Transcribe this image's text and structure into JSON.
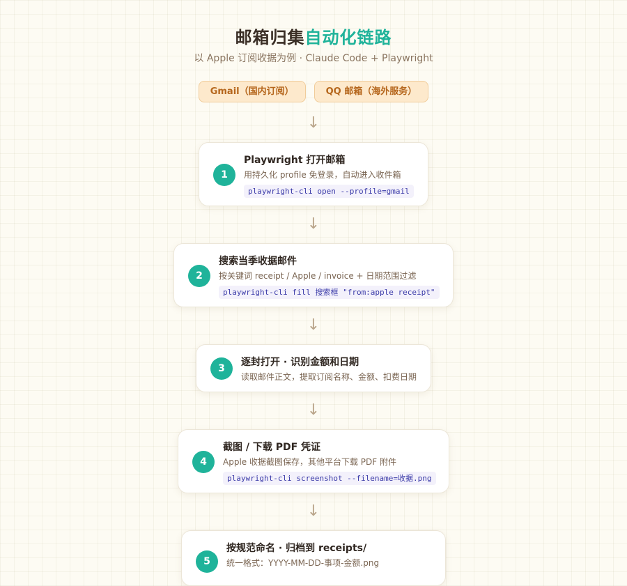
{
  "header": {
    "title_main": "邮箱归集",
    "title_accent": "自动化链路",
    "subtitle": "以 Apple 订阅收据为例 · Claude Code + Playwright"
  },
  "sources": [
    {
      "label": "Gmail（国内订阅）"
    },
    {
      "label": "QQ 邮箱（海外服务）"
    }
  ],
  "arrow_glyph": "↓",
  "steps": [
    {
      "number": "1",
      "title": "Playwright 打开邮箱",
      "desc": "用持久化 profile 免登录，自动进入收件箱",
      "code": "playwright-cli open --profile=gmail"
    },
    {
      "number": "2",
      "title": "搜索当季收据邮件",
      "desc": "按关键词 receipt / Apple / invoice + 日期范围过滤",
      "code": "playwright-cli fill 搜索框 \"from:apple receipt\""
    },
    {
      "number": "3",
      "title": "逐封打开 · 识别金额和日期",
      "desc": "读取邮件正文，提取订阅名称、金额、扣费日期"
    },
    {
      "number": "4",
      "title": "截图 / 下载 PDF 凭证",
      "desc": "Apple 收据截图保存，其他平台下载 PDF 附件",
      "code": "playwright-cli screenshot --filename=收据.png"
    },
    {
      "number": "5",
      "title": "按规范命名 · 归档到 receipts/",
      "desc": "统一格式：YYYY-MM-DD-事项-金额.png"
    }
  ],
  "colors": {
    "accent": "#1fb39a",
    "tag_text": "#b5661c",
    "tag_bg": "#fde9cc",
    "code_text": "#3a3aa8"
  }
}
